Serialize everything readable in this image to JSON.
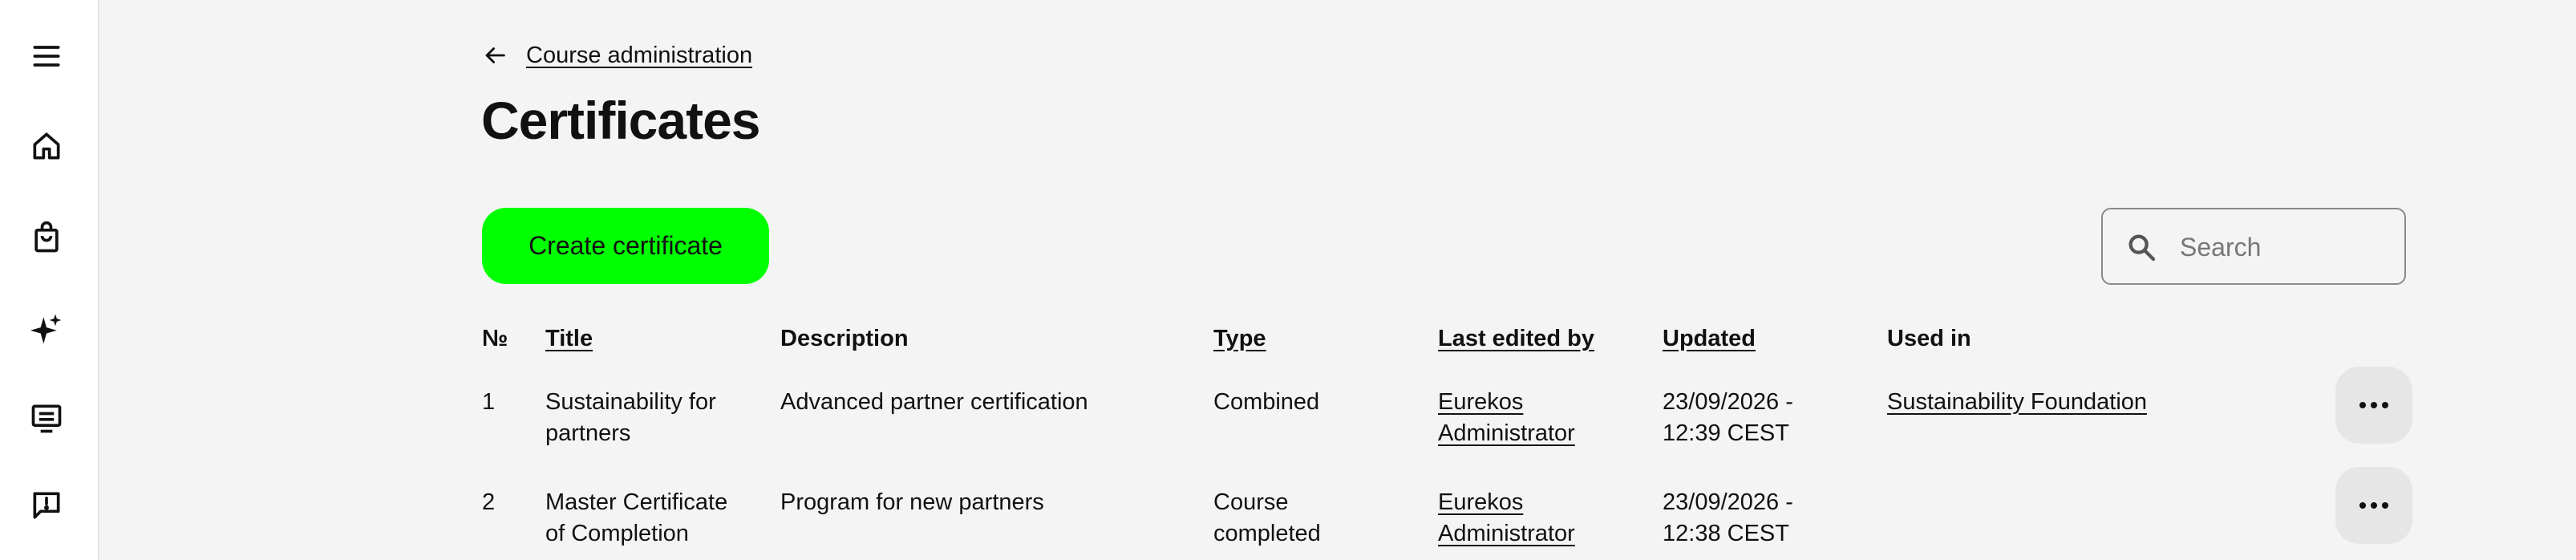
{
  "sidebar": {
    "items": [
      {
        "icon": "menu-icon"
      },
      {
        "icon": "home-icon"
      },
      {
        "icon": "shopping-bag-icon"
      },
      {
        "icon": "sparkle-icon"
      },
      {
        "icon": "presentation-icon"
      },
      {
        "icon": "feedback-icon"
      }
    ]
  },
  "breadcrumb": {
    "back_label": "Course administration"
  },
  "page": {
    "title": "Certificates"
  },
  "toolbar": {
    "create_label": "Create certificate",
    "accent_color": "#00ff00",
    "search_placeholder": "Search",
    "search_value": ""
  },
  "table": {
    "headers": {
      "number": "№",
      "title": "Title",
      "description": "Description",
      "type": "Type",
      "last_edited_by": "Last edited by",
      "updated": "Updated",
      "used_in": "Used in"
    },
    "rows": [
      {
        "number": "1",
        "title_line1": "Sustainability for",
        "title_line2": "partners",
        "description": "Advanced partner certification",
        "type_line1": "Combined",
        "type_line2": "",
        "editor_line1": "Eurekos",
        "editor_line2": "Administrator",
        "updated_line1": "23/09/2026 -",
        "updated_line2": "12:39 CEST",
        "used_in": "Sustainability Foundation"
      },
      {
        "number": "2",
        "title_line1": "Master Certificate",
        "title_line2": "of Completion",
        "description": "Program for new partners",
        "type_line1": "Course",
        "type_line2": "completed",
        "editor_line1": "Eurekos",
        "editor_line2": "Administrator",
        "updated_line1": "23/09/2026 -",
        "updated_line2": "12:38 CEST",
        "used_in": ""
      }
    ]
  }
}
